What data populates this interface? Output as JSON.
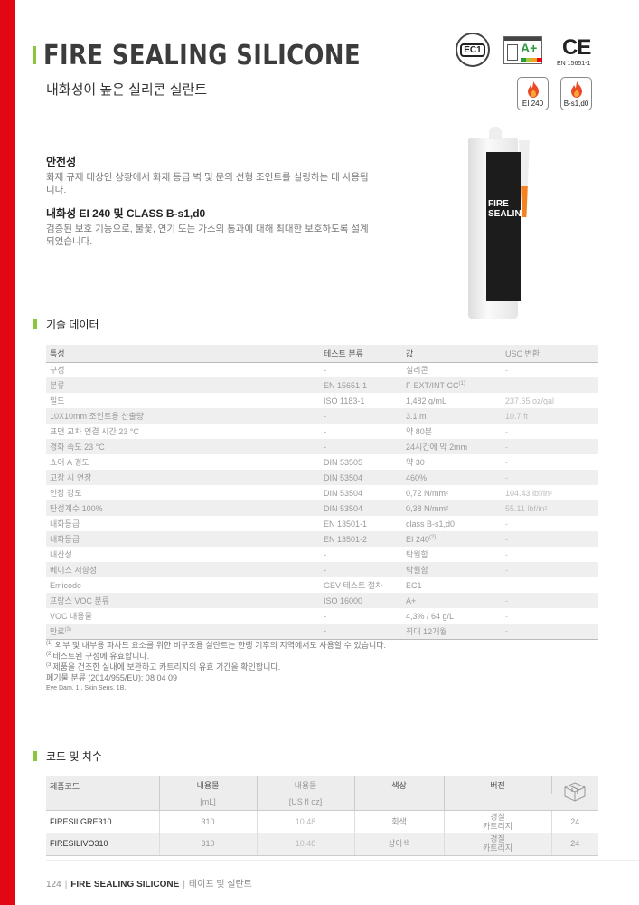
{
  "header": {
    "title": "FIRE SEALING SILICONE",
    "subtitle": "내화성이 높은 실리콘 실란트",
    "badges": {
      "ec1": "EC1",
      "voc": "A+",
      "ce": "CE",
      "ce_caption": "EN 15651-1",
      "fire1": "EI 240",
      "fire2": "B-s1,d0"
    }
  },
  "product_image": {
    "label_line1": "FIRE",
    "label_line2": "SEALIN"
  },
  "features": [
    {
      "heading": "안전성",
      "text": "화재 규제 대상인 상황에서 화재 등급 벽 및 문의 선형 조인트를 실링하는 데 사용됩니다."
    },
    {
      "heading": "내화성 EI 240 및 CLASS B-s1,d0",
      "text": "검증된 보호 기능으로, 불꽃, 연기 또는 가스의 통과에 대해 최대한 보호하도록 설계되었습니다."
    }
  ],
  "tech_section": {
    "title": "기술 데이터",
    "headers": [
      "특성",
      "테스트 분류",
      "값",
      "USC 변환"
    ],
    "rows": [
      [
        "구성",
        "-",
        "실리콘",
        "-"
      ],
      [
        "분류",
        "EN 15651-1",
        "F-EXT/INT-CC",
        "-"
      ],
      [
        "밀도",
        "ISO 1183-1",
        "1,482 g/mL",
        "237.65 oz/gal"
      ],
      [
        "10X10mm 조인트용 산출량",
        "-",
        "3.1 m",
        "10.7 ft"
      ],
      [
        "표면 교차 연결 시간 23 °C",
        "-",
        "약 80분",
        "-"
      ],
      [
        "경화 속도 23 °C",
        "-",
        "24시간에 약 2mm",
        "-"
      ],
      [
        "쇼어 A 경도",
        "DIN 53505",
        "약 30",
        "-"
      ],
      [
        "고장 시 연장",
        "DIN 53504",
        "460%",
        "-"
      ],
      [
        "인장 강도",
        "DIN 53504",
        "0,72 N/mm²",
        "104.43 lbf/in²"
      ],
      [
        "탄성계수 100%",
        "DIN 53504",
        "0,38 N/mm²",
        "55.11 lbf/in²"
      ],
      [
        "내화등급",
        "EN 13501-1",
        "class B-s1,d0",
        "-"
      ],
      [
        "내화등급",
        "EN 13501-2",
        "EI 240",
        "-"
      ],
      [
        "내산성",
        "-",
        "탁월함",
        "-"
      ],
      [
        "베이스 저항성",
        "-",
        "탁월함",
        "-"
      ],
      [
        "Emicode",
        "GEV 테스트 절차",
        "EC1",
        "-"
      ],
      [
        "프랑스 VOC 분류",
        "ISO 16000",
        "A+",
        "-"
      ],
      [
        "VOC 내용물",
        "-",
        "4,3% / 64 g/L",
        "-"
      ],
      [
        "만료",
        "-",
        "최대 12개월",
        "-"
      ]
    ],
    "footnote_marks": {
      "row1_value": "(1)",
      "row11_value": "(2)",
      "row17_label": "(3)"
    }
  },
  "notes": [
    {
      "mark": "(1)",
      "text": " 외부 및 내부용 파사드 요소를 위한 비구조용 실란트는 한랭 기후의 지역에서도 사용할 수 있습니다."
    },
    {
      "mark": "(2)",
      "text": "테스트된 구성에 유효합니다."
    },
    {
      "mark": "(3)",
      "text": "제품을 건조한 실내에 보관하고 카트리지의 유효 기간을 확인합니다."
    },
    {
      "mark": "",
      "text": "폐기물 분류 (2014/955/EU): 08 04 09"
    }
  ],
  "hazard_note": "Eye Dam. 1 . Skin Sens. 1B.",
  "codes_section": {
    "title": "코드 및 치수",
    "headers": [
      "제품코드",
      "내용물",
      "내용물",
      "색상",
      "버전",
      "box-icon"
    ],
    "units": [
      "",
      "[mL]",
      "[US fl oz]",
      "",
      "",
      ""
    ],
    "rows": [
      {
        "code": "FIRESILGRE310",
        "ml": "310",
        "floz": "10.48",
        "color": "회색",
        "version1": "경질",
        "version2": "카트리지",
        "pcs": "24"
      },
      {
        "code": "FIRESILIVO310",
        "ml": "310",
        "floz": "10.48",
        "color": "상아색",
        "version1": "경질",
        "version2": "카트리지",
        "pcs": "24"
      }
    ]
  },
  "footer": {
    "page": "124",
    "product": "FIRE SEALING SILICONE",
    "category": "테이프 및 실란트"
  },
  "colors": {
    "accent_red": "#e30613",
    "accent_green": "#8cc63f",
    "flame_orange": "#f58220"
  }
}
